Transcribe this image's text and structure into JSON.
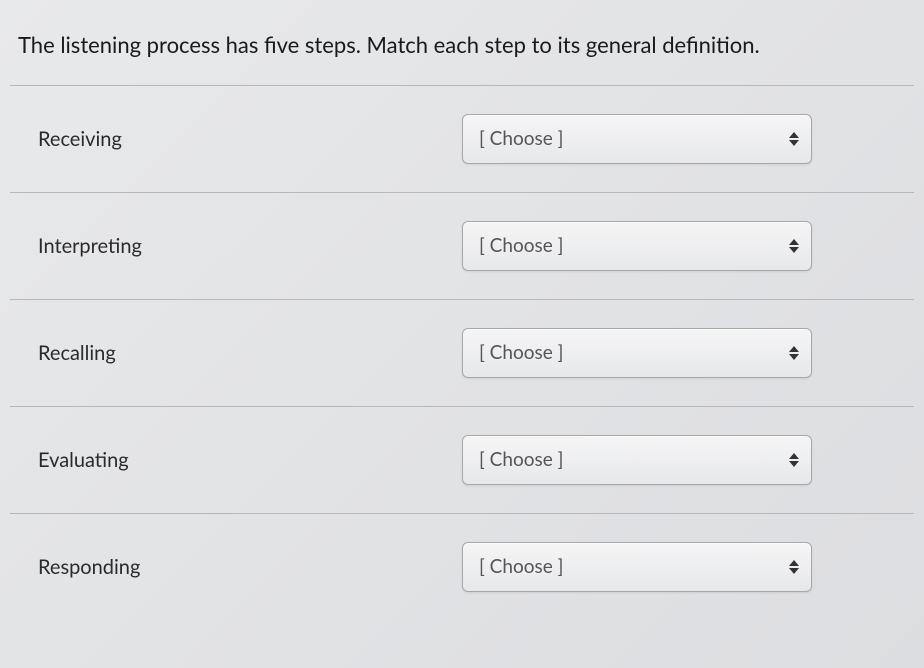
{
  "question": "The listening process has five steps. Match each step to its general definition.",
  "choose_placeholder": "[ Choose ]",
  "rows": [
    {
      "label": "Receiving"
    },
    {
      "label": "Interpreting"
    },
    {
      "label": "Recalling"
    },
    {
      "label": "Evaluating"
    },
    {
      "label": "Responding"
    }
  ]
}
